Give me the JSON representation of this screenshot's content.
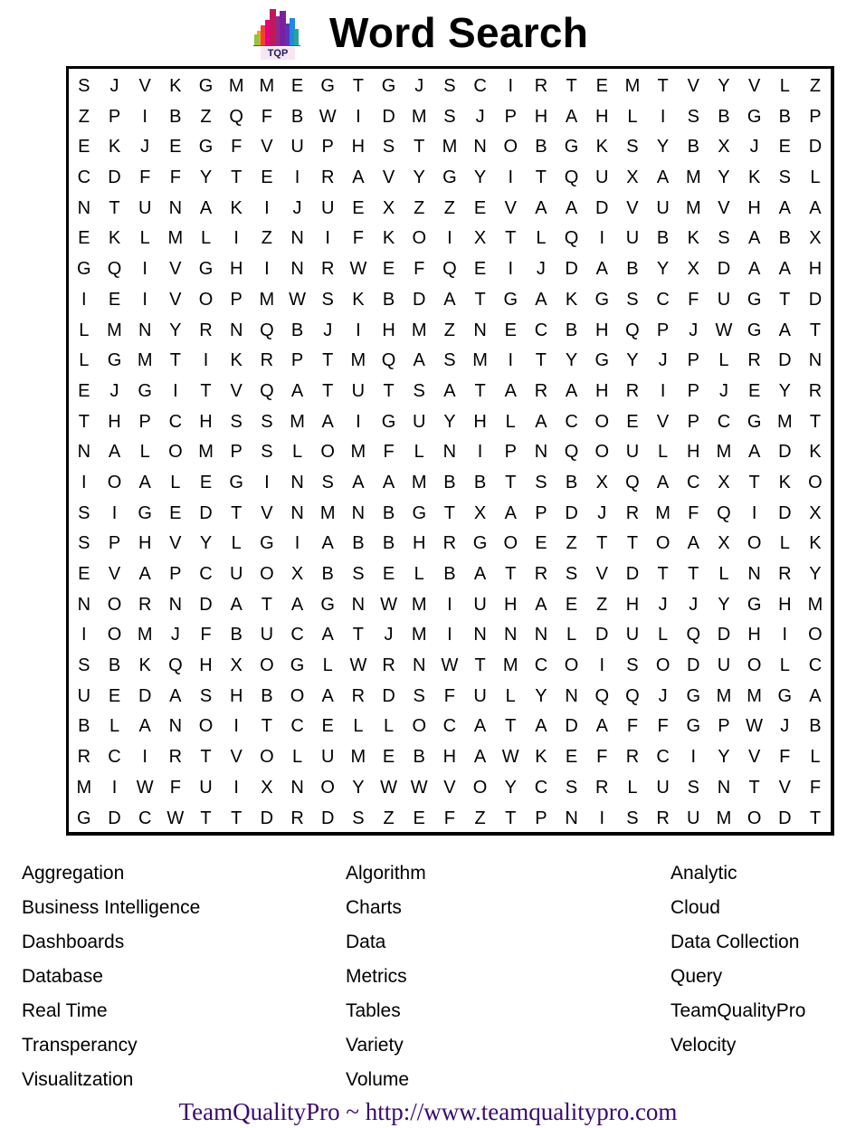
{
  "header": {
    "logo_text": "TQP",
    "title": "Word Search"
  },
  "grid": {
    "rows": [
      "SJVKGMMEGTGJSCIRTEMTVYVLZ",
      "ZPIBZQFBWIDMSJPHAHLISBGBP",
      "EKJEGFVUPHSTMNOBGKSYBXJED",
      "CDFFYTEIRAVYGYITQUXAMYKSL",
      "NTUNAKIJUEXZZEVAADVUMVHAA",
      "EKLMLIZNIFKOIXTLQIUBKSABX",
      "GQIVGHINRWEFQEIJDABYXDAAH",
      "IEIVOPMWSKBDATGAKGSCFUGTD",
      "LMNYRNQBJIHMZNECBHQPJWGAT",
      "LGMTIKRPTMQASMITYGYJPLRDN",
      "EJGITVQATUTSATARAHRIPJEYR",
      "THPCHSSMAIGUYHLACOEVPCGMT",
      "NALOMPSLOMFLNIPNQOULHMADK",
      "IOALEGINSAAMBBTSBXQACXTKO",
      "SIGEDTVNMNBGTXAPDJRMFQIDX",
      "SPHVYLGIABBHRGOEZTTOAXOLK",
      "EVAPCUOXBSELBATRSVDTTLNRY",
      "NORNDATAGNWMIUHAEZHJJYGHM",
      "IOMJFBUCATJMINNNLDULQDHIO",
      "SBKQHXOGLWRNWTMCOISODUOLC",
      "UEDASHBOARDSFULYNQQJGMMGA",
      "BLANOITCELLOCATADAFFGPWJB",
      "RCIRTVOLUMEBHAWKEFRCIYVFL",
      "MIWFUIXNOYWWVOYCSRLUSNTVF",
      "GDCWTTDRDSZEFZTPNISRUMODT"
    ]
  },
  "word_list": {
    "columns": [
      [
        "Aggregation",
        "Business Intelligence",
        "Dashboards",
        "Database",
        "Real Time",
        "Transperancy",
        "Visualitzation"
      ],
      [
        "Algorithm",
        "Charts",
        "Data",
        "Metrics",
        "Tables",
        "Variety",
        "Volume"
      ],
      [
        "Analytic",
        "Cloud",
        "Data Collection",
        "Query",
        "TeamQualityPro",
        "Velocity"
      ]
    ]
  },
  "footer": {
    "text": "TeamQualityPro ~ http://www.teamqualitypro.com"
  },
  "colors": {
    "footer_text": "#3a0a6e",
    "grid_border": "#000000"
  }
}
